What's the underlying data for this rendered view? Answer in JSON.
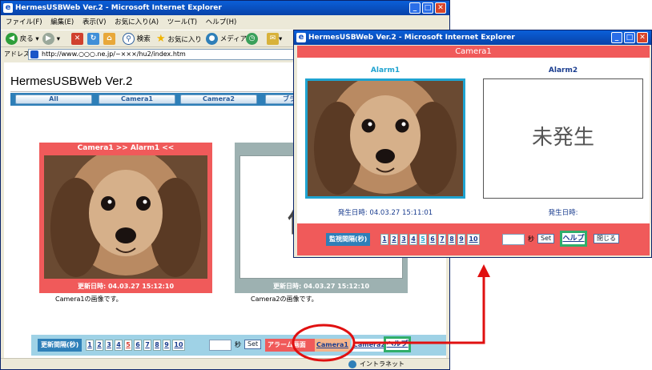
{
  "main_window": {
    "title": "HermesUSBWeb Ver.2 - Microsoft Internet Explorer",
    "menu": [
      "ファイル(F)",
      "編集(E)",
      "表示(V)",
      "お気に入り(A)",
      "ツール(T)",
      "ヘルプ(H)"
    ],
    "toolbar": {
      "back": "戻る",
      "search": "検索",
      "favorites": "お気に入り",
      "media": "メディア"
    },
    "address_label": "アドレス(D)",
    "address_url": "http://www.○○○.ne.jp/~×××/hu2/index.htm",
    "page_title": "HermesUSBWeb Ver.2",
    "nav_tabs": [
      "All",
      "Camera1",
      "Camera2",
      "ブラ"
    ],
    "camera1": {
      "header": "Camera1 >> Alarm1 <<",
      "updated": "更新日時: 04.03.27 15:12:10",
      "caption": "Camera1の画像です。"
    },
    "camera2": {
      "big_char": "便",
      "updated": "更新日時: 04.03.27 15:12:10",
      "caption": "Camera2の画像です。"
    },
    "bottom_bar": {
      "interval_label": "更新間隔(秒)",
      "numbers": [
        "1",
        "2",
        "3",
        "4",
        "5",
        "6",
        "7",
        "8",
        "9",
        "10"
      ],
      "sec_label": "秒",
      "set_label": "Set",
      "alarm_label": "アラーム画面",
      "camera1_link": "Camera1",
      "camera2_link": "Camera2",
      "help_label": "ヘルプ"
    },
    "status_intranet": "イントラネット"
  },
  "popup_window": {
    "title": "HermesUSBWeb Ver.2 - Microsoft Internet Explorer",
    "header": "Camera1",
    "alarm1": {
      "label": "Alarm1",
      "time": "発生日時: 04.03.27 15:11:01"
    },
    "alarm2": {
      "label": "Alarm2",
      "status": "未発生",
      "time": "発生日時:"
    },
    "bottom_bar": {
      "interval_label": "監視間隔(秒)",
      "numbers": [
        "1",
        "2",
        "3",
        "4",
        "5",
        "6",
        "7",
        "8",
        "9",
        "10"
      ],
      "sec_label": "秒",
      "set_label": "Set",
      "help_label": "ヘルプ",
      "close_label": "閉じる"
    }
  },
  "colors": {
    "accent_red": "#f05a5a",
    "highlight_cyan": "#1fa3d0",
    "help_green": "#2fae6a",
    "annotation_red": "#e01010"
  }
}
